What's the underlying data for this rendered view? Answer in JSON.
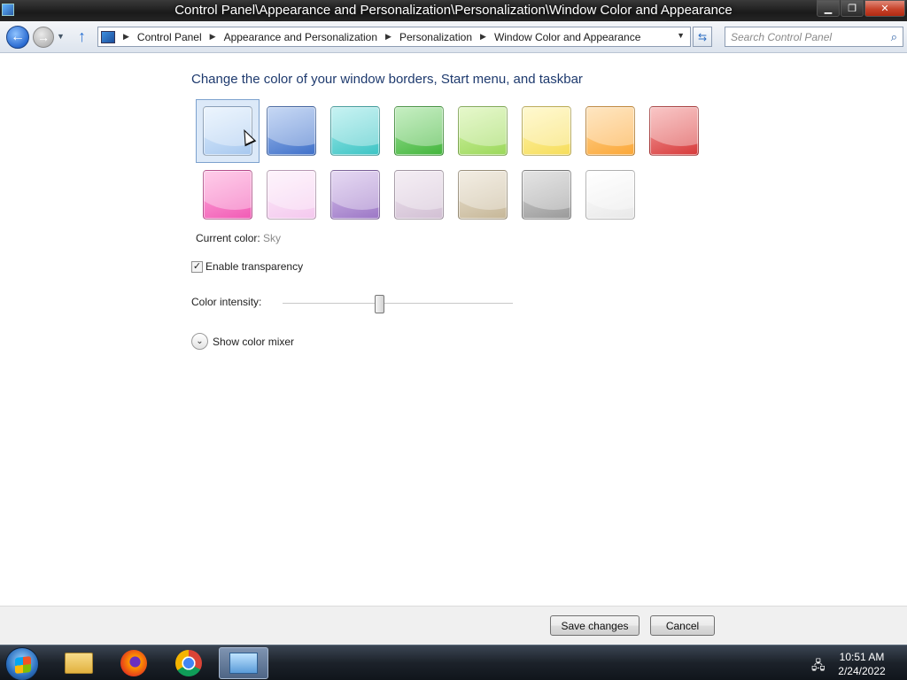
{
  "window": {
    "title": "Control Panel\\Appearance and Personalization\\Personalization\\Window Color and Appearance",
    "minimize_glyph": "▁",
    "maximize_glyph": "❐",
    "close_glyph": "✕"
  },
  "nav": {
    "back_glyph": "←",
    "forward_glyph": "→",
    "recent_glyph": "▼",
    "up_glyph": "↑",
    "breadcrumbs": [
      "Control Panel",
      "Appearance and Personalization",
      "Personalization",
      "Window Color and Appearance"
    ],
    "crumb_separator": "▶",
    "dropdown_glyph": "▼",
    "refresh_glyph": "⇆",
    "search_placeholder": "Search Control Panel",
    "search_glyph": "⌕"
  },
  "main": {
    "heading": "Change the color of your window borders, Start menu, and taskbar",
    "swatches": [
      {
        "color_top": "#e3f0fd",
        "color_bottom": "#a7c8ef",
        "selected": true
      },
      {
        "color_top": "#a8c3ef",
        "color_bottom": "#3f70c9",
        "selected": false
      },
      {
        "color_top": "#a9ecec",
        "color_bottom": "#3cc4c4",
        "selected": false
      },
      {
        "color_top": "#a8e6a2",
        "color_bottom": "#42b53b",
        "selected": false
      },
      {
        "color_top": "#d9f5b0",
        "color_bottom": "#9bd85a",
        "selected": false
      },
      {
        "color_top": "#fff6b7",
        "color_bottom": "#f6dd5a",
        "selected": false
      },
      {
        "color_top": "#ffd9a1",
        "color_bottom": "#fba736",
        "selected": false
      },
      {
        "color_top": "#f6a8a8",
        "color_bottom": "#d73a3a",
        "selected": false
      },
      {
        "color_top": "#ffb2de",
        "color_bottom": "#f15bb5",
        "selected": false
      },
      {
        "color_top": "#fdeefa",
        "color_bottom": "#f4c8ee",
        "selected": false
      },
      {
        "color_top": "#d8c4ec",
        "color_bottom": "#9c77c6",
        "selected": false
      },
      {
        "color_top": "#efe5ef",
        "color_bottom": "#d2c0d4",
        "selected": false
      },
      {
        "color_top": "#ece4d4",
        "color_bottom": "#c6b798",
        "selected": false
      },
      {
        "color_top": "#d6d6d6",
        "color_bottom": "#9a9a9a",
        "selected": false
      },
      {
        "color_top": "#ffffff",
        "color_bottom": "#e8e8e8",
        "selected": false
      }
    ],
    "current_color_label": "Current color:",
    "current_color_value": "Sky",
    "transparency_label": "Enable transparency",
    "transparency_checked": true,
    "transparency_check_glyph": "✓",
    "intensity_label": "Color intensity:",
    "intensity_value": 0.42,
    "mixer_label": "Show color mixer",
    "mixer_glyph": "⌄"
  },
  "buttons": {
    "save": "Save changes",
    "cancel": "Cancel"
  },
  "taskbar": {
    "items": [
      {
        "name": "file-explorer",
        "active": false
      },
      {
        "name": "firefox",
        "active": false
      },
      {
        "name": "chrome",
        "active": false
      },
      {
        "name": "control-panel",
        "active": true
      }
    ],
    "network_glyph": "🖧",
    "time": "10:51 AM",
    "date": "2/24/2022"
  }
}
